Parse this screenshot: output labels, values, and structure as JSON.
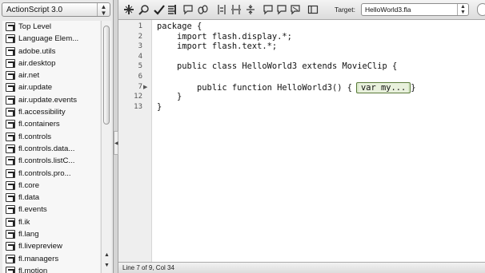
{
  "language_select": {
    "value": "ActionScript 3.0"
  },
  "packages": [
    "Top Level",
    "Language Elem...",
    "adobe.utils",
    "air.desktop",
    "air.net",
    "air.update",
    "air.update.events",
    "fl.accessibility",
    "fl.containers",
    "fl.controls",
    "fl.controls.data...",
    "fl.controls.listC...",
    "fl.controls.pro...",
    "fl.core",
    "fl.data",
    "fl.events",
    "fl.ik",
    "fl.lang",
    "fl.livepreview",
    "fl.managers",
    "fl.motion"
  ],
  "toolbar": {
    "icons": [
      "add-statement-icon",
      "find-icon",
      "check-syntax-icon",
      "auto-format-icon",
      "code-hint-icon",
      "debug-options-icon",
      "collapse-between-braces-icon",
      "collapse-selection-icon",
      "expand-all-icon",
      "apply-block-comment-icon",
      "apply-line-comment-icon",
      "remove-comment-icon",
      "show-hide-toolbox-icon"
    ],
    "target_label": "Target:",
    "target_value": "HelloWorld3.fla"
  },
  "editor": {
    "lines": [
      {
        "num": "1",
        "text": "package {",
        "fold": ""
      },
      {
        "num": "2",
        "text": "    import flash.display.*;",
        "fold": ""
      },
      {
        "num": "3",
        "text": "    import flash.text.*;",
        "fold": ""
      },
      {
        "num": "4",
        "text": "",
        "fold": ""
      },
      {
        "num": "5",
        "text": "    public class HelloWorld3 extends MovieClip {",
        "fold": ""
      },
      {
        "num": "6",
        "text": "",
        "fold": ""
      },
      {
        "num": "7",
        "text": "        public function HelloWorld3() {",
        "fold": "▶"
      },
      {
        "num": "12",
        "text": "    }",
        "fold": ""
      },
      {
        "num": "13",
        "text": "}",
        "fold": ""
      }
    ],
    "collapsed_label": "var my...",
    "collapsed_suffix": "}"
  },
  "status": "Line 7 of 9, Col 34",
  "colors": {
    "collapsed_border": "#5a7a3a",
    "collapsed_fill": "#d8e8c8"
  }
}
